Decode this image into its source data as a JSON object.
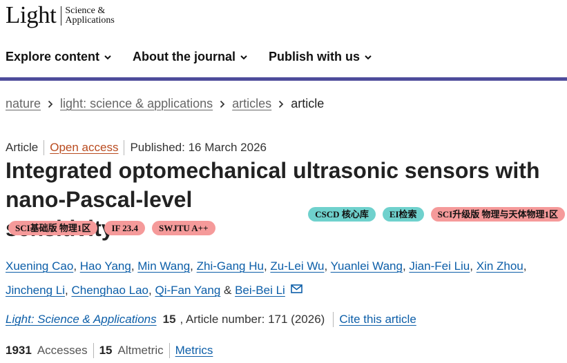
{
  "brand": {
    "word": "Light",
    "sub1": "Science &",
    "sub2": "Applications"
  },
  "nav": {
    "items": [
      "Explore content",
      "About the journal",
      "Publish with us"
    ]
  },
  "breadcrumb": {
    "items": [
      "nature",
      "light: science & applications",
      "articles"
    ],
    "current": "article"
  },
  "meta": {
    "type": "Article",
    "access": "Open access",
    "published": "Published: 16 March 2026"
  },
  "title": {
    "line1": "Integrated optomechanical ultrasonic sensors with",
    "line2": "nano-Pascal-level sensitivity"
  },
  "badges": {
    "b1": "CSCD 核心库",
    "b2": "EI检索",
    "b3": "SCI升级版 物理与天体物理1区",
    "b4": "SCI基础版 物理1区",
    "b5": "IF 23.4",
    "b6": "SWJTU A++",
    "colors": {
      "teal": "#6fd1cd",
      "pink": "#f59a9a"
    }
  },
  "authors": [
    "Xuening Cao",
    "Hao Yang",
    "Min Wang",
    "Zhi-Gang Hu",
    "Zu-Lei Wu",
    "Yuanlei Wang",
    "Jian-Fei Liu",
    "Xin Zhou",
    "Jincheng Li",
    "Chenghao Lao",
    "Qi-Fan Yang",
    "Bei-Bei Li"
  ],
  "author_sep": {
    "comma": ", ",
    "amp": " & "
  },
  "journal": {
    "name": "Light: Science & Applications",
    "volume": "15",
    "article": ", Article number: 171 (2026)",
    "cite": "Cite this article"
  },
  "metrics": {
    "accesses_count": "1931",
    "accesses_label": "Accesses",
    "altmetric_count": "15",
    "altmetric_label": "Altmetric",
    "metrics_link": "Metrics"
  },
  "icons": {
    "chevron": "chevron-down-icon",
    "breadcrumb_sep": "chevron-right-icon",
    "mail": "mail-icon"
  },
  "accent": {
    "nav_bar": "#4e4c9b",
    "link": "#0c5ea8",
    "open_access": "#b94a1e"
  }
}
